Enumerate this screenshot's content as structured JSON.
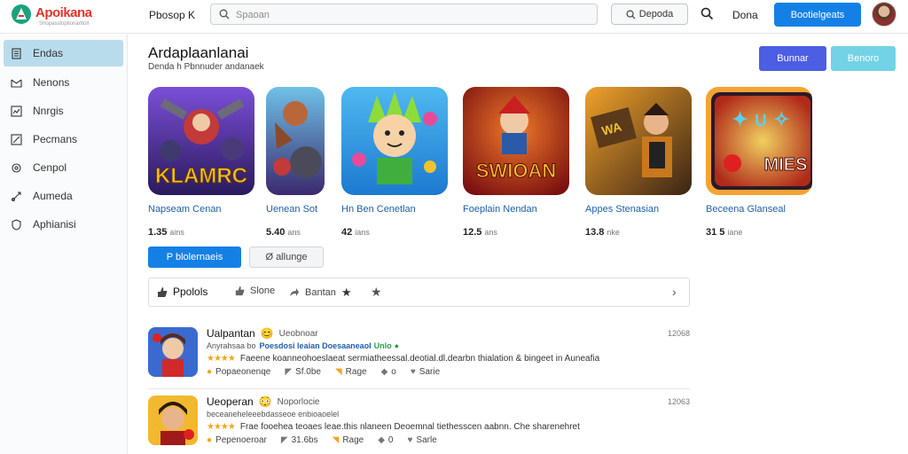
{
  "brand": {
    "name": "Apoikana",
    "tagline": "Shopasstoptionarttoll",
    "logo_colors": [
      "#1aa37a",
      "#e0342c"
    ]
  },
  "header": {
    "app_name": "Pbosop K",
    "search_placeholder": "Spaoan",
    "search_button_label": "Depoda",
    "link_label": "Dona",
    "primary_button_label": "Bootielgeats"
  },
  "sidebar": {
    "items": [
      {
        "label": "Endas",
        "icon": "document-icon",
        "active": true
      },
      {
        "label": "Nenons",
        "icon": "mail-icon",
        "active": false
      },
      {
        "label": "Nnrgis",
        "icon": "chart-icon",
        "active": false
      },
      {
        "label": "Pecmans",
        "icon": "trend-icon",
        "active": false
      },
      {
        "label": "Cenpol",
        "icon": "settings-icon",
        "active": false
      },
      {
        "label": "Aumeda",
        "icon": "share-icon",
        "active": false
      },
      {
        "label": "Aphianisi",
        "icon": "shield-icon",
        "active": false
      }
    ]
  },
  "main": {
    "title": "Ardaplaanlanai",
    "subtitle": "Denda h Pbnnuder andanaek",
    "btn_purple": "Bunnar",
    "btn_teal": "Benoro",
    "cards": [
      {
        "title": "Napseam Cenan",
        "rating": "1.35",
        "unit": "ains",
        "art_text": "KLAMRC",
        "palette": [
          "#4b2a8e",
          "#f2c12e"
        ]
      },
      {
        "title": "Uenean Sot",
        "rating": "5.40",
        "unit": "ans",
        "art_text": "",
        "palette": [
          "#3a2a6e",
          "#6fc1e8"
        ]
      },
      {
        "title": "Hn Ben Cenetlan",
        "rating": "42",
        "unit": "ians",
        "art_text": "",
        "palette": [
          "#2b9be0",
          "#74cf44"
        ]
      },
      {
        "title": "Foeplain Nendan",
        "rating": "12.5",
        "unit": "ans",
        "art_text": "SWIOAN",
        "palette": [
          "#a52020",
          "#f0b02a"
        ]
      },
      {
        "title": "Appes Stenasian",
        "rating": "13.8",
        "unit": "nke",
        "art_text": "",
        "palette": [
          "#c9781d",
          "#33241a"
        ]
      },
      {
        "title": "Beceena Glanseal",
        "rating": "31 5",
        "unit": "iane",
        "art_text": "MIES",
        "palette": [
          "#f3a433",
          "#e14a2a"
        ]
      }
    ],
    "btn_blue": "P blolernaeis",
    "btn_gray": "Ø allunge",
    "filters": {
      "first": "Ppolols",
      "second": "Slone",
      "third": "Bantan"
    },
    "reviews": [
      {
        "name": "Ualpantan",
        "emoji": "😊",
        "handle": "Ueobnoar",
        "date": "12068",
        "tagline": "Anyrahsaa bo",
        "tagline_highlight": "Poesdosi leaian Doesaaneaol",
        "tagline_green": "Unlo",
        "stars": "★★★★",
        "body": "Faeene koanneohoeslaeat sermiatheessal.deotial.dl.dearbn thialation & bingeet in Auneafia",
        "actions": [
          "Popaeonenqe",
          "Sf.0be",
          "Rage",
          "o",
          "Sarie"
        ]
      },
      {
        "name": "Ueoperan",
        "emoji": "😳",
        "handle": "Noporlocie",
        "date": "12063",
        "tagline": "beceaneheleeebdasseoe enbioaoelel",
        "tagline_highlight": "",
        "tagline_green": "",
        "stars": "★★★★",
        "body": "Frae fooehea teoaes leae.this nlaneen Deoemnal tiethesscen aabnn. Che sharenehret",
        "actions": [
          "Pepenoeroar",
          "31.6bs",
          "Rage",
          "0",
          "Sarle"
        ]
      }
    ]
  }
}
